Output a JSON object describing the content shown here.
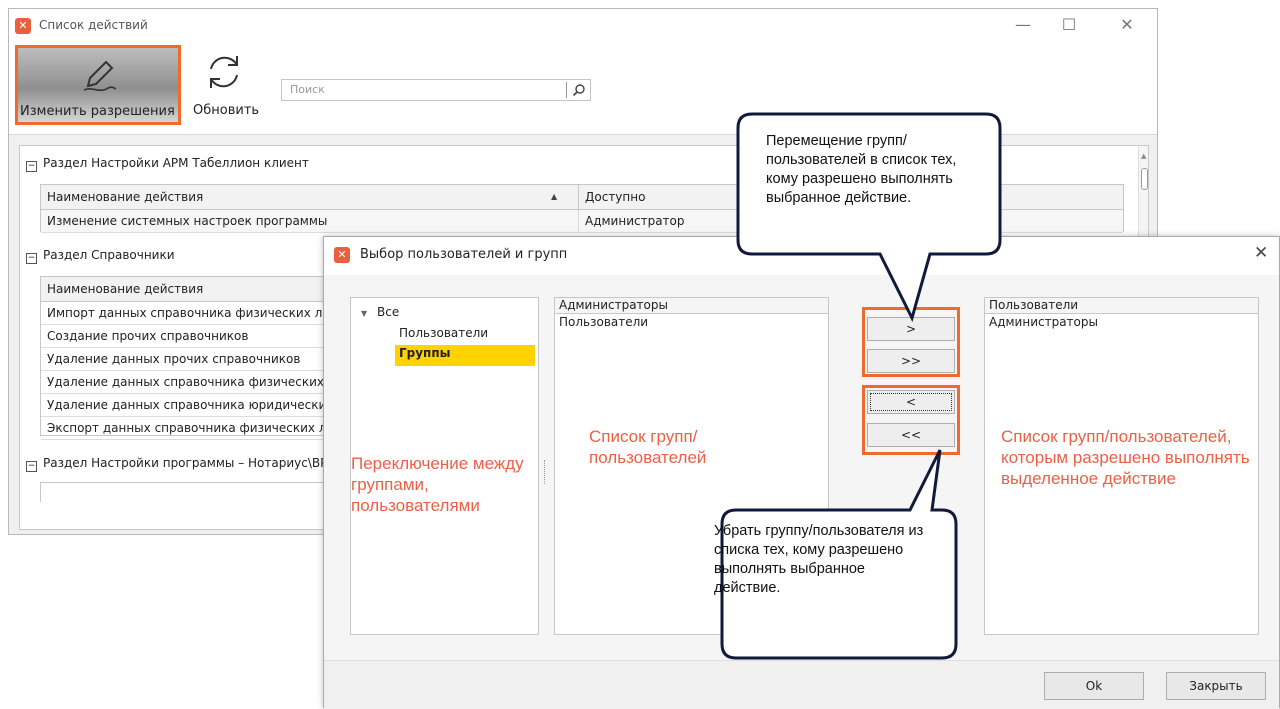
{
  "main_window": {
    "title": "Список действий",
    "toolbar": {
      "edit_label": "Изменить разрешения",
      "refresh_label": "Обновить",
      "search_placeholder": "Поиск"
    },
    "sections": [
      {
        "title": "Раздел Настройки АРМ Табеллион клиент",
        "columns": [
          "Наименование действия",
          "Доступно"
        ],
        "rows": [
          [
            "Изменение системных настроек программы",
            "Администратор"
          ]
        ]
      },
      {
        "title": "Раздел Справочники",
        "columns": [
          "Наименование действия"
        ],
        "rows": [
          "Импорт данных справочника физических лиц",
          "Создание прочих справочников",
          "Удаление данных прочих справочников",
          "Удаление данных справочника физических л",
          "Удаление данных справочника юридических",
          "Экспорт данных справочника физических ли"
        ]
      },
      {
        "title": "Раздел Настройки программы – Нотариус\\ВР"
      }
    ]
  },
  "dialog": {
    "title": "Выбор пользователей и групп",
    "tree": {
      "root": "Все",
      "items": [
        "Пользователи",
        "Группы"
      ],
      "selected": "Группы"
    },
    "available_list": {
      "header": "Администраторы",
      "items": [
        "Пользователи"
      ]
    },
    "allowed_list": {
      "header": "Пользователи",
      "items": [
        "Администраторы"
      ]
    },
    "buttons": {
      "add": ">",
      "add_all": ">>",
      "remove": "<",
      "remove_all": "<<"
    },
    "notes": {
      "tree_note": "Переключение между группами, пользователями",
      "available_note": "Список групп/пользователей",
      "allowed_note": "Список групп/пользователей, которым разрешено выполнять выделенное действие"
    },
    "footer": {
      "ok": "Ok",
      "close": "Закрыть"
    }
  },
  "callouts": {
    "top": "Перемещение групп/пользователей в список тех, кому разрешено выполнять выбранное действие.",
    "bottom": "Убрать группу/пользователя из списка тех, кому разрешено выполнять выбранное действие."
  },
  "colors": {
    "accent": "#ef6a2c",
    "note_red": "#ec6048",
    "selected": "#ffd200",
    "app_icon": "#e8603c"
  }
}
